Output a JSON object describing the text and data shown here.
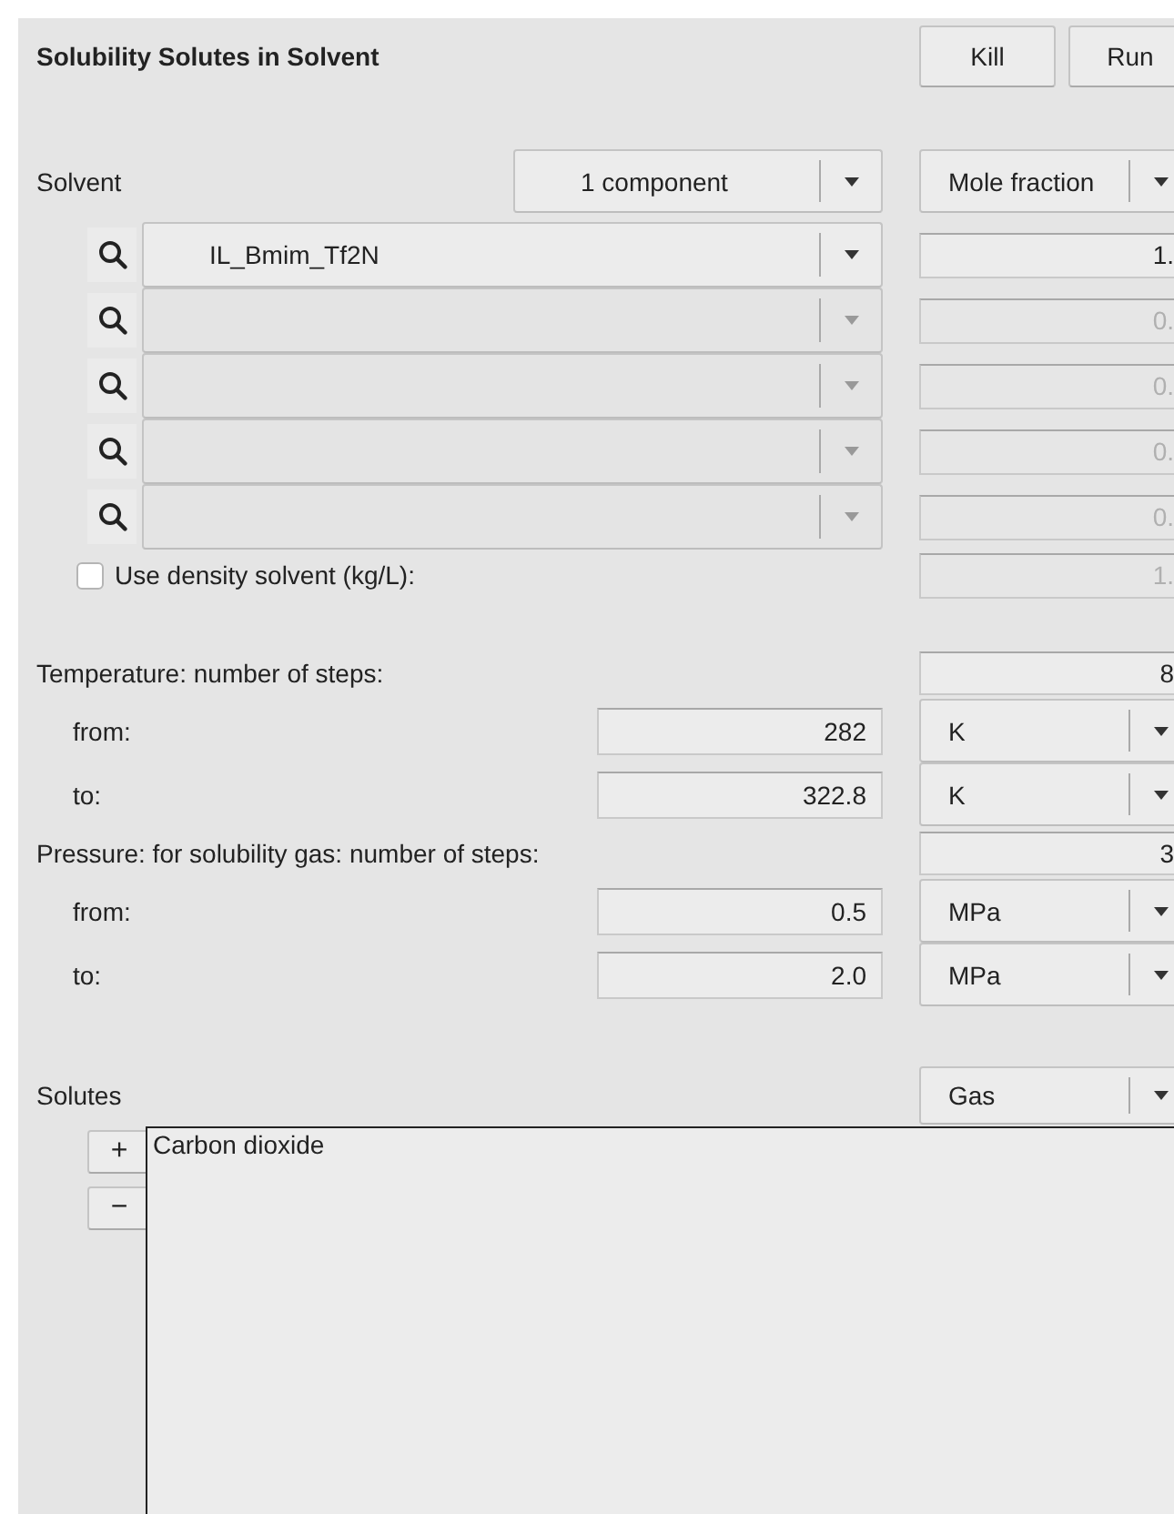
{
  "title": "Solubility Solutes in Solvent",
  "buttons": [
    "Kill",
    "Run"
  ],
  "solvent": {
    "label": "Solvent",
    "count_select": "1 component",
    "unit_select": "Mole fraction",
    "components": [
      {
        "name": "IL_Bmim_Tf2N",
        "fraction": "1.",
        "disabled": false
      },
      {
        "fraction": "0.",
        "disabled": true
      },
      {
        "fraction": "0.",
        "disabled": true
      },
      {
        "fraction": "0.",
        "disabled": true
      },
      {
        "fraction": "0.",
        "disabled": true
      }
    ]
  },
  "density": {
    "label": "Use density solvent (kg/L):",
    "checked": false,
    "value": "1."
  },
  "temperature": {
    "label": "Temperature: number of steps:",
    "steps": "8",
    "range": [
      {
        "label": "from:",
        "value": "282",
        "unit": "K"
      },
      {
        "label": "to:",
        "value": "322.8",
        "unit": "K"
      }
    ]
  },
  "pressure": {
    "label": "Pressure: for solubility gas: number of steps:",
    "steps": "3",
    "range": [
      {
        "label": "from:",
        "value": "0.5",
        "unit": "MPa"
      },
      {
        "label": "to:",
        "value": "2.0",
        "unit": "MPa"
      }
    ]
  },
  "solutes": {
    "label": "Solutes",
    "phase": "Gas",
    "add": "+",
    "remove": "−",
    "items": [
      {
        "name": "Carbon dioxide",
        "selected": false
      }
    ]
  }
}
